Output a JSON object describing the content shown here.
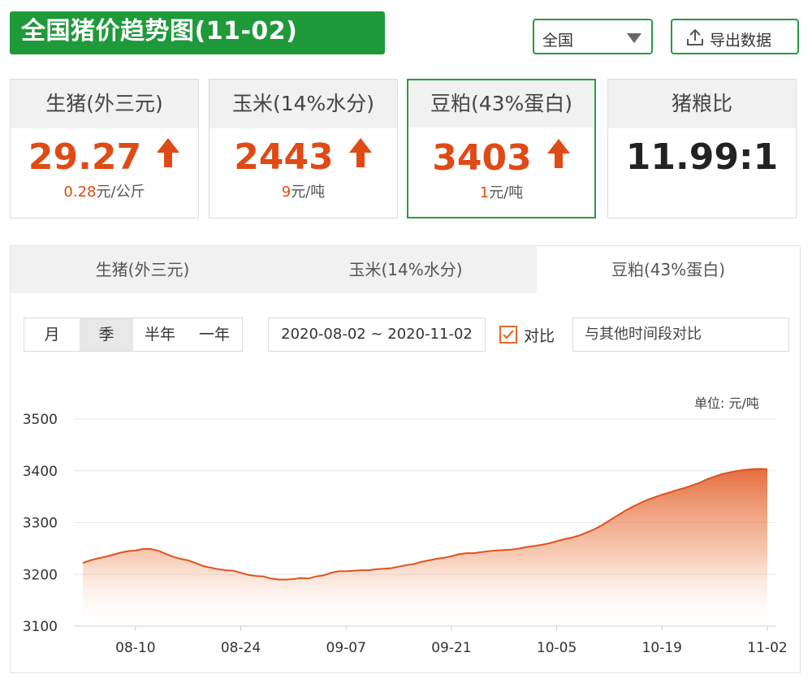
{
  "header": {
    "title": "全国猪价趋势图(11-02)",
    "region": "全国",
    "export_label": "导出数据"
  },
  "cards": [
    {
      "name": "生猪(外三元)",
      "price": "29.27",
      "change_num": "0.28",
      "change_unit": "元/公斤",
      "arrow": "up"
    },
    {
      "name": "玉米(14%水分)",
      "price": "2443",
      "change_num": "9",
      "change_unit": "元/吨",
      "arrow": "up"
    },
    {
      "name": "豆粕(43%蛋白)",
      "price": "3403",
      "change_num": "1",
      "change_unit": "元/吨",
      "arrow": "up"
    },
    {
      "name": "猪粮比",
      "value": "11.99:1"
    }
  ],
  "tabs": [
    "生猪(外三元)",
    "玉米(14%水分)",
    "豆粕(43%蛋白)"
  ],
  "active_tab": 2,
  "range_options": [
    "月",
    "季",
    "半年",
    "一年"
  ],
  "active_range": 1,
  "date_range": "2020-08-02 ~ 2020-11-02",
  "compare": {
    "checked": true,
    "label": "对比",
    "placeholder": "与其他时间段对比"
  },
  "colors": {
    "accent_green": "#1f9a3a",
    "price_orange": "#e04a14",
    "line": "#e0531c"
  },
  "chart_data": {
    "type": "area",
    "unit": "单位: 元/吨",
    "ylim": [
      3100,
      3500
    ],
    "yticks": [
      3100,
      3200,
      3300,
      3400,
      3500
    ],
    "x_ticks": [
      "08-10",
      "08-24",
      "09-07",
      "09-21",
      "10-05",
      "10-19",
      "11-02"
    ],
    "x": [
      "08-03",
      "08-04",
      "08-05",
      "08-06",
      "08-07",
      "08-08",
      "08-09",
      "08-10",
      "08-11",
      "08-12",
      "08-13",
      "08-14",
      "08-15",
      "08-16",
      "08-17",
      "08-18",
      "08-19",
      "08-20",
      "08-21",
      "08-22",
      "08-23",
      "08-24",
      "08-25",
      "08-26",
      "08-27",
      "08-28",
      "08-29",
      "08-30",
      "08-31",
      "09-01",
      "09-02",
      "09-03",
      "09-04",
      "09-05",
      "09-06",
      "09-07",
      "09-08",
      "09-09",
      "09-10",
      "09-11",
      "09-12",
      "09-13",
      "09-14",
      "09-15",
      "09-16",
      "09-17",
      "09-18",
      "09-19",
      "09-20",
      "09-21",
      "09-22",
      "09-23",
      "09-24",
      "09-25",
      "09-26",
      "09-27",
      "09-28",
      "09-29",
      "09-30",
      "10-01",
      "10-02",
      "10-03",
      "10-04",
      "10-05",
      "10-06",
      "10-07",
      "10-08",
      "10-09",
      "10-10",
      "10-11",
      "10-12",
      "10-13",
      "10-14",
      "10-15",
      "10-16",
      "10-17",
      "10-18",
      "10-19",
      "10-20",
      "10-21",
      "10-22",
      "10-23",
      "10-24",
      "10-25",
      "10-26",
      "10-27",
      "10-28",
      "10-29",
      "10-30",
      "10-31",
      "11-01",
      "11-02"
    ],
    "values": [
      3222,
      3227,
      3231,
      3234,
      3238,
      3242,
      3245,
      3246,
      3249,
      3249,
      3246,
      3240,
      3234,
      3230,
      3227,
      3222,
      3216,
      3213,
      3210,
      3208,
      3207,
      3203,
      3199,
      3197,
      3196,
      3192,
      3190,
      3190,
      3191,
      3193,
      3192,
      3196,
      3198,
      3203,
      3206,
      3206,
      3207,
      3208,
      3208,
      3210,
      3211,
      3212,
      3215,
      3218,
      3220,
      3224,
      3227,
      3230,
      3232,
      3235,
      3239,
      3241,
      3241,
      3243,
      3245,
      3246,
      3247,
      3248,
      3250,
      3253,
      3255,
      3257,
      3260,
      3264,
      3268,
      3271,
      3275,
      3281,
      3287,
      3295,
      3304,
      3313,
      3322,
      3330,
      3337,
      3344,
      3349,
      3354,
      3358,
      3363,
      3367,
      3372,
      3377,
      3384,
      3389,
      3394,
      3397,
      3400,
      3402,
      3403,
      3404,
      3403
    ]
  }
}
